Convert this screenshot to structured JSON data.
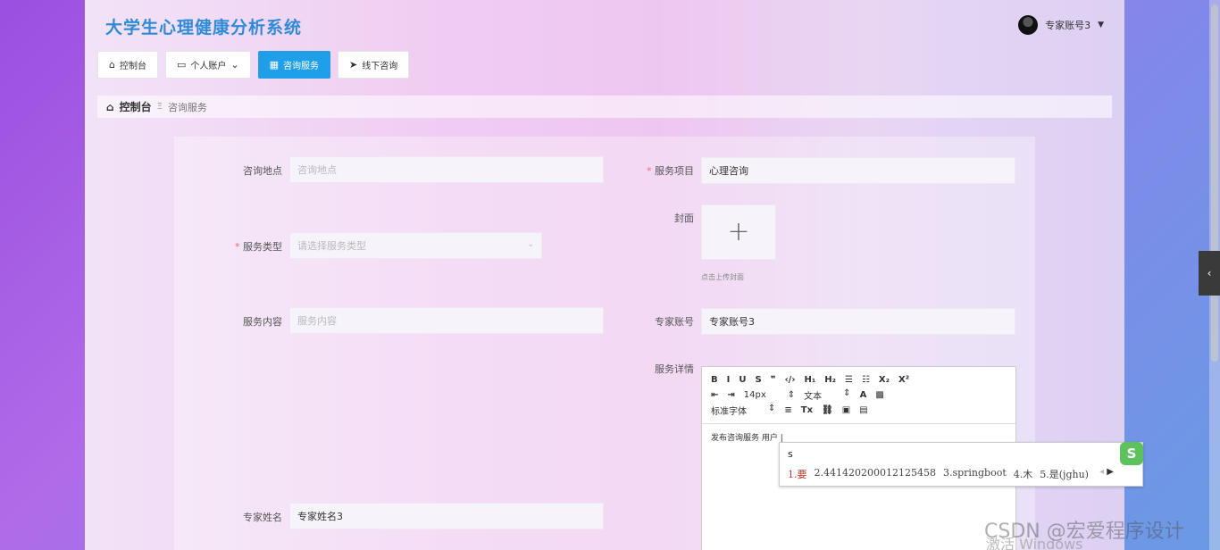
{
  "app": {
    "title": "大学生心理健康分析系统"
  },
  "user": {
    "name": "专家账号3",
    "caret": "▼"
  },
  "nav": {
    "items": [
      {
        "label": "控制台",
        "icon": "⌂"
      },
      {
        "label": "个人账户",
        "icon": "▭",
        "suffix": "⌄"
      },
      {
        "label": "咨询服务",
        "icon": "▦"
      },
      {
        "label": "线下咨询",
        "icon": "➤"
      }
    ]
  },
  "breadcrumb": {
    "home": "控制台",
    "separator": "Ξ",
    "current": "咨询服务"
  },
  "form": {
    "location_label": "咨询地点",
    "location_placeholder": "咨询地点",
    "project_label": "服务项目",
    "project_value": "心理咨询",
    "cover_label": "封面",
    "cover_plus": "+",
    "cover_tip": "点击上传封面",
    "type_label": "服务类型",
    "type_placeholder": "请选择服务类型",
    "type_arrow": "⌄",
    "content_label": "服务内容",
    "content_placeholder": "服务内容",
    "expert_account_label": "专家账号",
    "expert_account_value": "专家账号3",
    "details_label": "服务详情",
    "expert_name_label": "专家姓名",
    "expert_name_value": "专家姓名3"
  },
  "editor": {
    "row1": [
      "B",
      "I",
      "U",
      "S",
      "❞",
      "‹/›",
      "H₁",
      "H₂",
      "☰",
      "☷",
      "X₂",
      "X²"
    ],
    "font_size": "14px",
    "text_style": "文本",
    "font_family": "标准字体",
    "body": "发布咨询服务 用户 |"
  },
  "ime": {
    "input": "s",
    "candidates": [
      "1.要",
      "2.441420200012125458",
      "3.springboot",
      "4.木",
      "5.是(jghu)"
    ],
    "logo": "S"
  },
  "watermark": "CSDN @宏爱程序设计",
  "activate": "激活 Windows"
}
